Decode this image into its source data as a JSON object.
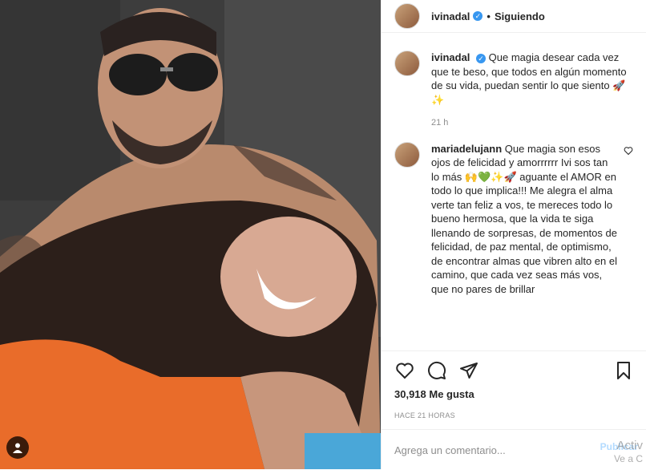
{
  "post": {
    "username": "ivinadal",
    "separator": "•",
    "follow_status": "Siguiendo",
    "caption_user": "ivinadal",
    "caption": "Que magia desear cada vez que te beso, que todos en algún momento de su vida, puedan sentir lo que siento 🚀✨",
    "caption_time": "21 h",
    "comment_user": "mariadelujann",
    "comment": "Que magia son esos ojos de felicidad y amorrrrrr Ivi sos tan lo más 🙌💚✨🚀 aguante el AMOR en todo lo que implica!!! Me alegra el alma verte tan feliz a vos, te mereces todo lo bueno hermosa, que la vida te siga llenando de sorpresas, de momentos de felicidad, de paz mental, de optimismo, de encontrar almas que vibren alto en el camino, que cada vez seas más vos, que no pares de brillar",
    "likes": "30,918 Me gusta",
    "posted_ago": "HACE 21 HORAS",
    "add_comment_placeholder": "Agrega un comentario...",
    "publish_label": "Publicar"
  },
  "watermark": {
    "line1": "Activ",
    "line2": "Ve a C"
  },
  "icons": [
    "heart-icon",
    "comment-icon",
    "share-icon",
    "bookmark-icon",
    "user-tag-icon",
    "verified-badge-icon"
  ],
  "colors": {
    "verified": "#3897f0",
    "text": "#262626",
    "muted": "#8e8e8e",
    "publish": "#b3dbff"
  }
}
